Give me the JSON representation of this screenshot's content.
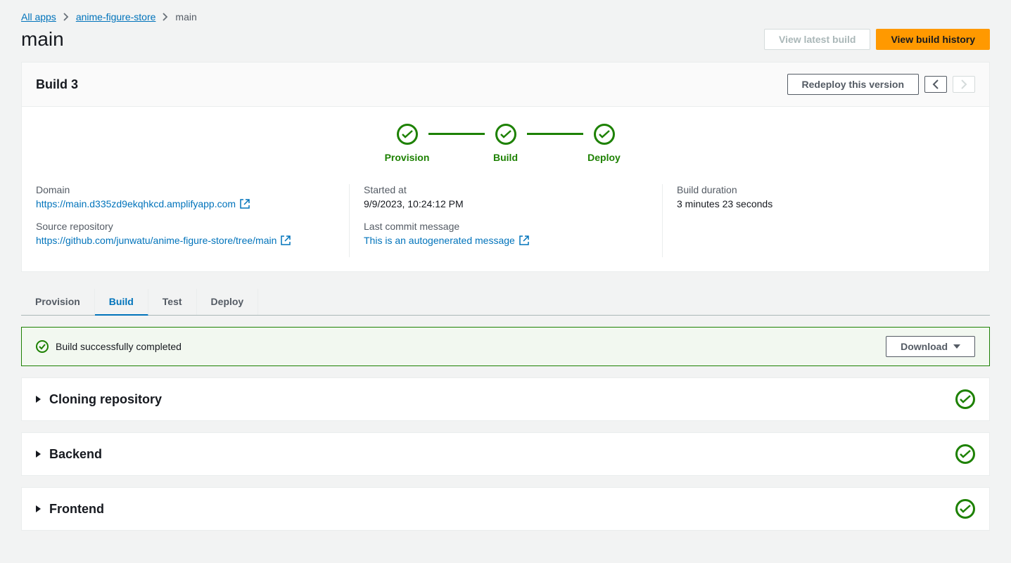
{
  "breadcrumb": {
    "all_apps": "All apps",
    "app_name": "anime-figure-store",
    "current": "main"
  },
  "page_title": "main",
  "header_buttons": {
    "view_latest": "View latest build",
    "view_history": "View build history"
  },
  "build_card": {
    "title": "Build 3",
    "redeploy": "Redeploy this version"
  },
  "pipeline": {
    "provision": "Provision",
    "build": "Build",
    "deploy": "Deploy"
  },
  "info": {
    "domain_label": "Domain",
    "domain_url": "https://main.d335zd9ekqhkcd.amplifyapp.com",
    "source_label": "Source repository",
    "source_url": "https://github.com/junwatu/anime-figure-store/tree/main",
    "started_label": "Started at",
    "started_value": "9/9/2023, 10:24:12 PM",
    "commit_label": "Last commit message",
    "commit_msg": "This is an autogenerated message",
    "duration_label": "Build duration",
    "duration_value": "3 minutes 23 seconds"
  },
  "tabs": {
    "provision": "Provision",
    "build": "Build",
    "test": "Test",
    "deploy": "Deploy"
  },
  "banner": {
    "message": "Build successfully completed",
    "download": "Download"
  },
  "steps": {
    "cloning": "Cloning repository",
    "backend": "Backend",
    "frontend": "Frontend"
  }
}
